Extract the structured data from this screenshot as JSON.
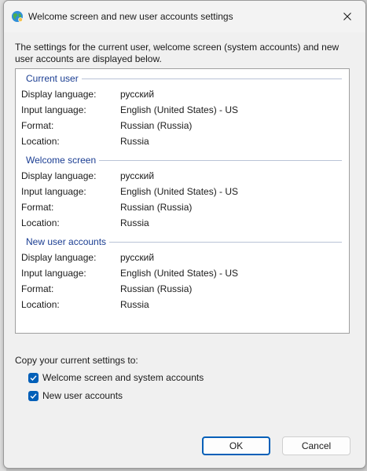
{
  "window": {
    "title": "Welcome screen and new user accounts settings",
    "close_icon": "close-icon",
    "app_icon": "globe-icon"
  },
  "description": "The settings for the current user, welcome screen (system accounts) and new user accounts are displayed below.",
  "groups": [
    {
      "header": "Current user",
      "rows": [
        {
          "label": "Display language:",
          "value": "русский"
        },
        {
          "label": "Input language:",
          "value": "English (United States) - US"
        },
        {
          "label": "Format:",
          "value": "Russian (Russia)"
        },
        {
          "label": "Location:",
          "value": "Russia"
        }
      ]
    },
    {
      "header": "Welcome screen",
      "rows": [
        {
          "label": "Display language:",
          "value": "русский"
        },
        {
          "label": "Input language:",
          "value": "English (United States) - US"
        },
        {
          "label": "Format:",
          "value": "Russian (Russia)"
        },
        {
          "label": "Location:",
          "value": "Russia"
        }
      ]
    },
    {
      "header": "New user accounts",
      "rows": [
        {
          "label": "Display language:",
          "value": "русский"
        },
        {
          "label": "Input language:",
          "value": "English (United States) - US"
        },
        {
          "label": "Format:",
          "value": "Russian (Russia)"
        },
        {
          "label": "Location:",
          "value": "Russia"
        }
      ]
    }
  ],
  "copy": {
    "label": "Copy your current settings to:",
    "options": [
      {
        "label": "Welcome screen and system accounts",
        "checked": true
      },
      {
        "label": "New user accounts",
        "checked": true
      }
    ]
  },
  "buttons": {
    "ok": "OK",
    "cancel": "Cancel"
  },
  "colors": {
    "accent": "#005fb8",
    "group_header": "#1a3d92"
  }
}
